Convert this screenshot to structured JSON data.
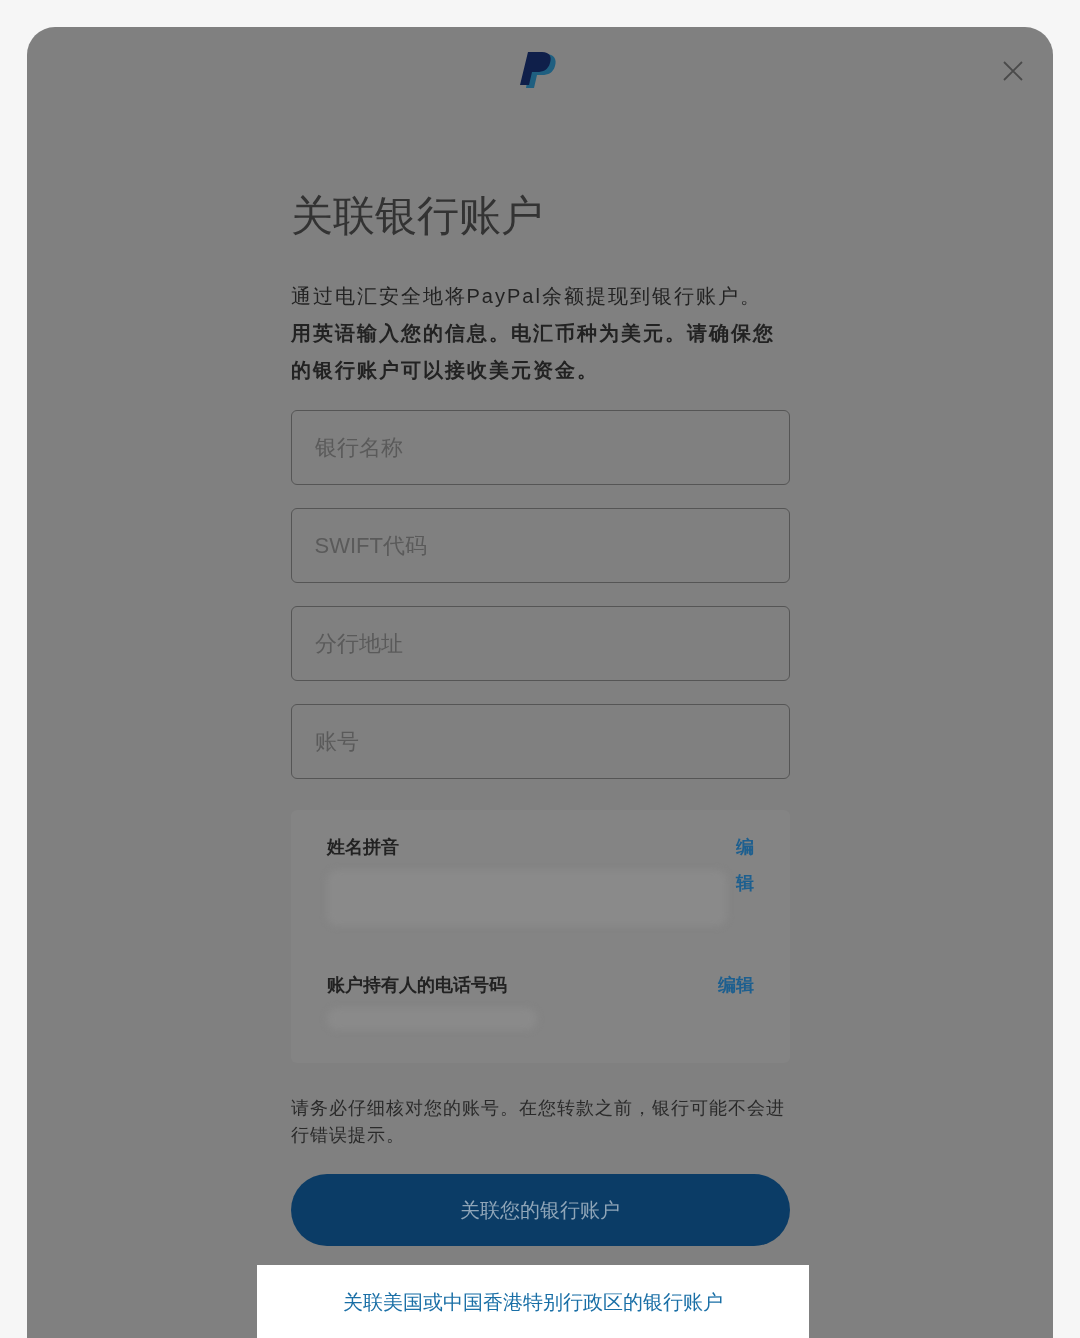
{
  "dialog": {
    "title": "关联银行账户",
    "intro": "通过电汇安全地将PayPal余额提现到银行账户。",
    "intro_emphasis": "用英语输入您的信息。电汇币种为美元。请确保您的银行账户可以接收美元资金。"
  },
  "fields": [
    {
      "placeholder": "银行名称"
    },
    {
      "placeholder": "SWIFT代码"
    },
    {
      "placeholder": "分行地址"
    },
    {
      "placeholder": "账号"
    }
  ],
  "info_rows": [
    {
      "label": "姓名拼音",
      "action": "编辑",
      "kind": "stacked"
    },
    {
      "label": "账户持有人的电话号码",
      "action": "编辑",
      "kind": "inline"
    }
  ],
  "note": "请务必仔细核对您的账号。在您转款之前，银行可能不会进行错误提示。",
  "submit_button": "关联您的银行账户",
  "alt_link": "关联美国或中国香港特别行政区的银行账户"
}
